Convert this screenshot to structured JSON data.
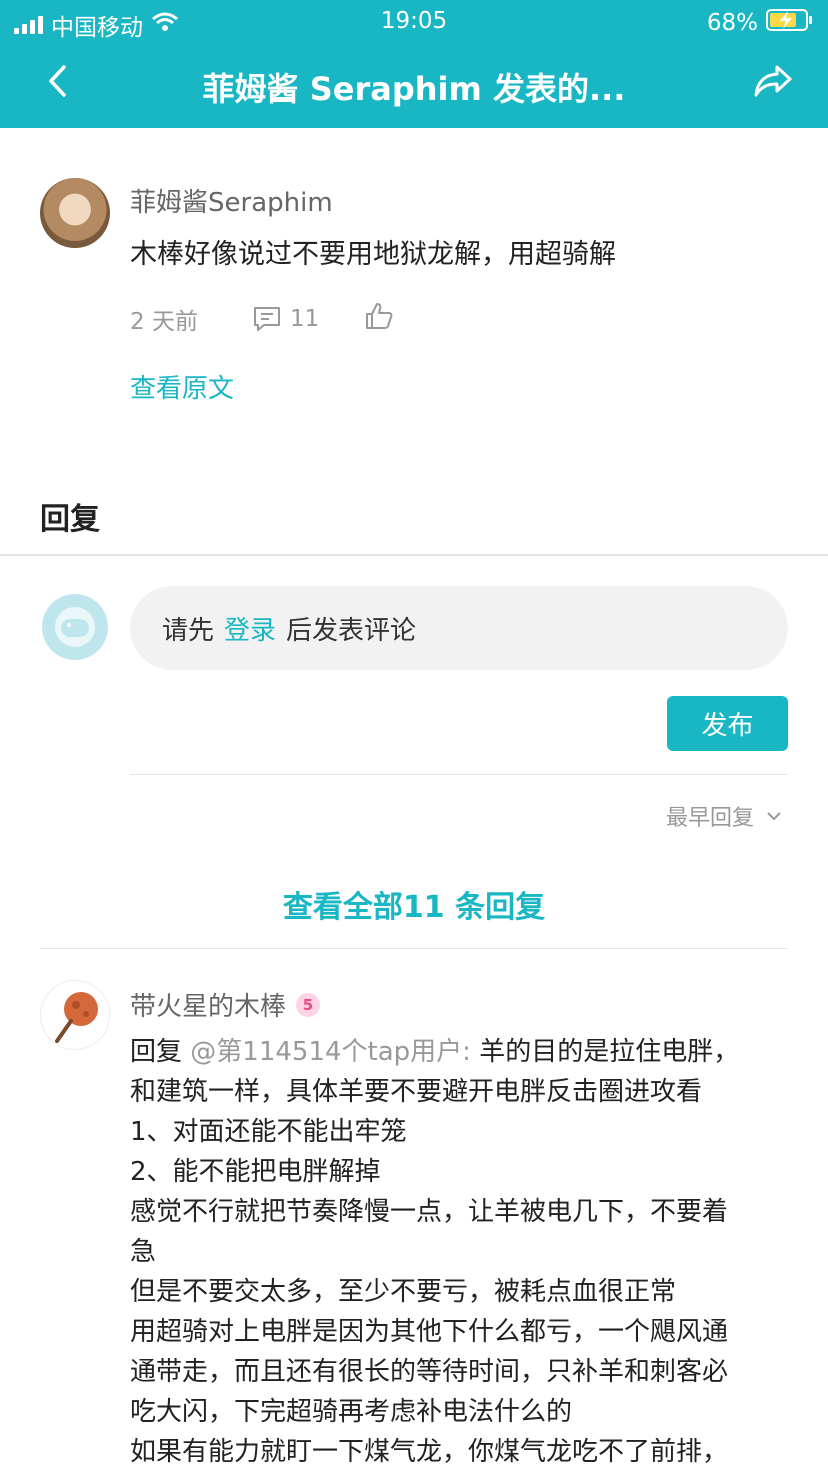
{
  "status": {
    "carrier": "中国移动",
    "time": "19:05",
    "battery": "68%"
  },
  "nav": {
    "title": "菲姆酱 Seraphim 发表的..."
  },
  "post": {
    "author": "菲姆酱Seraphim",
    "text": "木棒好像说过不要用地狱龙解，用超骑解",
    "time": "2 天前",
    "comment_count": "11",
    "view_original": "查看原文"
  },
  "reply_section": {
    "heading": "回复",
    "input_prefix": "请先",
    "input_login": "登录",
    "input_suffix": "后发表评论",
    "publish": "发布",
    "sort": "最早回复",
    "view_all": "查看全部11 条回复"
  },
  "reply": {
    "author": "带火星的木棒",
    "badge": "5",
    "prefix": "回复",
    "mention": "@第114514个tap用户:",
    "lines": [
      "羊的目的是拉住电胖，",
      "和建筑一样，具体羊要不要避开电胖反击圈进攻看",
      "1、对面还能不能出牢笼",
      "2、能不能把电胖解掉",
      "感觉不行就把节奏降慢一点，让羊被电几下，不要着",
      "急",
      "但是不要交太多，至少不要亏，被耗点血很正常",
      "用超骑对上电胖是因为其他下什么都亏，一个飓风通",
      "通带走，而且还有很长的等待时间，只补羊和刺客必",
      "吃大闪，下完超骑再考虑补电法什么的",
      "如果有能力就盯一下煤气龙，你煤气龙吃不了前排，"
    ]
  }
}
